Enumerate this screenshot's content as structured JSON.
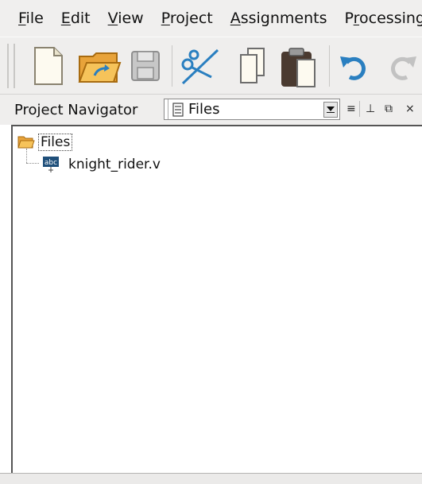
{
  "menu": {
    "items": [
      {
        "accel": "F",
        "rest": "ile"
      },
      {
        "accel": "E",
        "rest": "dit"
      },
      {
        "accel": "V",
        "rest": "iew"
      },
      {
        "accel": "P",
        "rest": "roject"
      },
      {
        "accel": "A",
        "rest": "ssignments"
      },
      {
        "pre": "P",
        "accel": "r",
        "rest": "ocessing"
      }
    ]
  },
  "toolbar": {
    "icons": [
      "new-file-icon",
      "open-folder-icon",
      "save-icon",
      "cut-icon",
      "copy-icon",
      "paste-icon",
      "undo-icon",
      "redo-icon"
    ]
  },
  "navigator": {
    "title": "Project Navigator",
    "view_select": "Files",
    "controls": {
      "list": "≡",
      "pin": "⊥",
      "float": "⧉",
      "close": "×"
    }
  },
  "tree": {
    "root_label": "Files",
    "children": [
      {
        "icon_text": "abc",
        "label": "knight_rider.v"
      }
    ]
  },
  "colors": {
    "folder": "#e8a33a",
    "toolbar_blue": "#2a7fc0",
    "paste_dark": "#4a3a30"
  }
}
